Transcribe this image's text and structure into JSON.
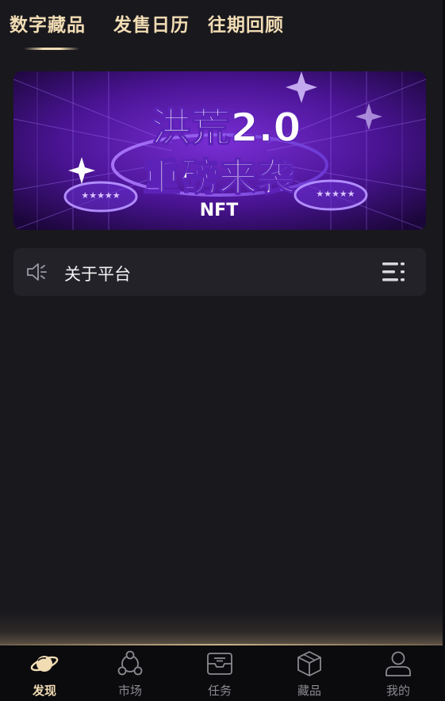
{
  "top_tabs": [
    {
      "label": "数字藏品",
      "active": true
    },
    {
      "label": "发售日历",
      "active": false
    },
    {
      "label": "往期回顾",
      "active": false
    }
  ],
  "banner": {
    "title_line1": "洪荒2.0",
    "title_line2": "重磅来袭",
    "tag": "NFT",
    "stars_left": "★★★★★",
    "stars_right": "★★★★★"
  },
  "notice": {
    "icon": "speaker-icon",
    "text": "关于平台",
    "menu_icon": "list-menu-icon"
  },
  "bottom_nav": [
    {
      "label": "发现",
      "icon": "planet-icon",
      "active": true
    },
    {
      "label": "市场",
      "icon": "network-icon",
      "active": false
    },
    {
      "label": "任务",
      "icon": "inbox-icon",
      "active": false
    },
    {
      "label": "藏品",
      "icon": "box-icon",
      "active": false
    },
    {
      "label": "我的",
      "icon": "user-icon",
      "active": false
    }
  ],
  "colors": {
    "background": "#19181d",
    "accent_gold": "#f1dcb4",
    "notice_bg": "#232229",
    "nav_bg": "#0b0a0d",
    "inactive_gray": "#8a8a90"
  }
}
